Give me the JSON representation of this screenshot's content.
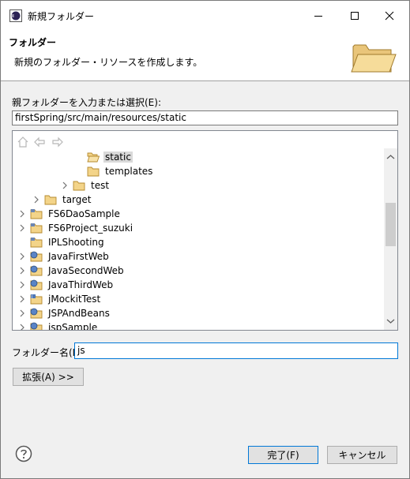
{
  "window": {
    "title": "新規フォルダー"
  },
  "banner": {
    "title": "フォルダー",
    "description": "新規のフォルダー・リソースを作成します。"
  },
  "parent": {
    "label": "親フォルダーを入力または選択(E):",
    "value": "firstSpring/src/main/resources/static"
  },
  "tree": {
    "items": [
      {
        "label": "static",
        "depth": 4,
        "expander": "none",
        "icon": "folder-open-icon",
        "selected": true
      },
      {
        "label": "templates",
        "depth": 4,
        "expander": "none",
        "icon": "folder-icon",
        "selected": false
      },
      {
        "label": "test",
        "depth": 3,
        "expander": "collapsed",
        "icon": "folder-icon",
        "selected": false
      },
      {
        "label": "target",
        "depth": 1,
        "expander": "collapsed",
        "icon": "folder-icon",
        "selected": false
      },
      {
        "label": "FS6DaoSample",
        "depth": 0,
        "expander": "collapsed",
        "icon": "project-icon",
        "selected": false
      },
      {
        "label": "FS6Project_suzuki",
        "depth": 0,
        "expander": "collapsed",
        "icon": "project-icon",
        "selected": false
      },
      {
        "label": "IPLShooting",
        "depth": 0,
        "expander": "none",
        "icon": "project-icon",
        "selected": false
      },
      {
        "label": "JavaFirstWeb",
        "depth": 0,
        "expander": "collapsed",
        "icon": "web-project-icon",
        "selected": false
      },
      {
        "label": "JavaSecondWeb",
        "depth": 0,
        "expander": "collapsed",
        "icon": "web-project-icon",
        "selected": false
      },
      {
        "label": "JavaThirdWeb",
        "depth": 0,
        "expander": "collapsed",
        "icon": "web-project-icon",
        "selected": false
      },
      {
        "label": "jMockitTest",
        "depth": 0,
        "expander": "collapsed",
        "icon": "java-project-icon",
        "selected": false
      },
      {
        "label": "JSPAndBeans",
        "depth": 0,
        "expander": "collapsed",
        "icon": "web-project-icon",
        "selected": false
      },
      {
        "label": "jspSample",
        "depth": 0,
        "expander": "collapsed",
        "icon": "web-project-icon",
        "selected": false
      }
    ]
  },
  "folder_name": {
    "label": "フォルダー名(N):",
    "value": "js"
  },
  "advanced_button": "拡張(A) >>",
  "finish_button": "完了(F)",
  "cancel_button": "キャンセル"
}
